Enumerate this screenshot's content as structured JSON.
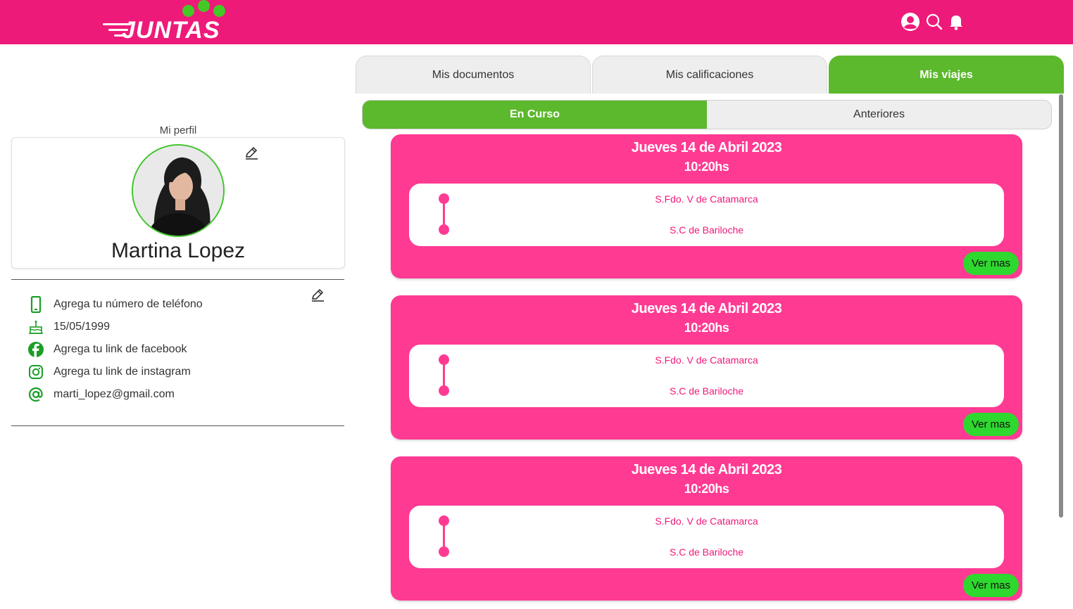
{
  "app": {
    "logo_text": "JUNTAS",
    "brand_color": "#ee1a7a",
    "accent_green": "#5cb82c",
    "card_pink": "#ff3a93",
    "header_icons": [
      "user-circle-icon",
      "search-icon",
      "bell-icon"
    ]
  },
  "profile": {
    "section_title": "Mi perfil",
    "name": "Martina Lopez",
    "info": [
      {
        "icon": "phone-icon",
        "text": "Agrega tu número de teléfono"
      },
      {
        "icon": "cake-icon",
        "text": "15/05/1999"
      },
      {
        "icon": "facebook-icon",
        "text": "Agrega tu link de facebook"
      },
      {
        "icon": "instagram-icon",
        "text": "Agrega tu link de instagram"
      },
      {
        "icon": "at-icon",
        "text": "marti_lopez@gmail.com"
      }
    ]
  },
  "tabs": [
    {
      "label": "Mis documentos",
      "active": false
    },
    {
      "label": "Mis calificaciones",
      "active": false
    },
    {
      "label": "Mis viajes",
      "active": true
    }
  ],
  "subtabs": [
    {
      "label": "En Curso",
      "active": true
    },
    {
      "label": "Anteriores",
      "active": false
    }
  ],
  "trips": [
    {
      "date": "Jueves 14 de Abril 2023",
      "time": "10:20hs",
      "from": "S.Fdo. V de Catamarca",
      "to": "S.C de Bariloche",
      "button": "Ver mas"
    },
    {
      "date": "Jueves 14 de Abril 2023",
      "time": "10:20hs",
      "from": "S.Fdo. V de Catamarca",
      "to": "S.C de Bariloche",
      "button": "Ver mas"
    },
    {
      "date": "Jueves 14 de Abril 2023",
      "time": "10:20hs",
      "from": "S.Fdo. V de Catamarca",
      "to": "S.C de Bariloche",
      "button": "Ver mas"
    }
  ]
}
